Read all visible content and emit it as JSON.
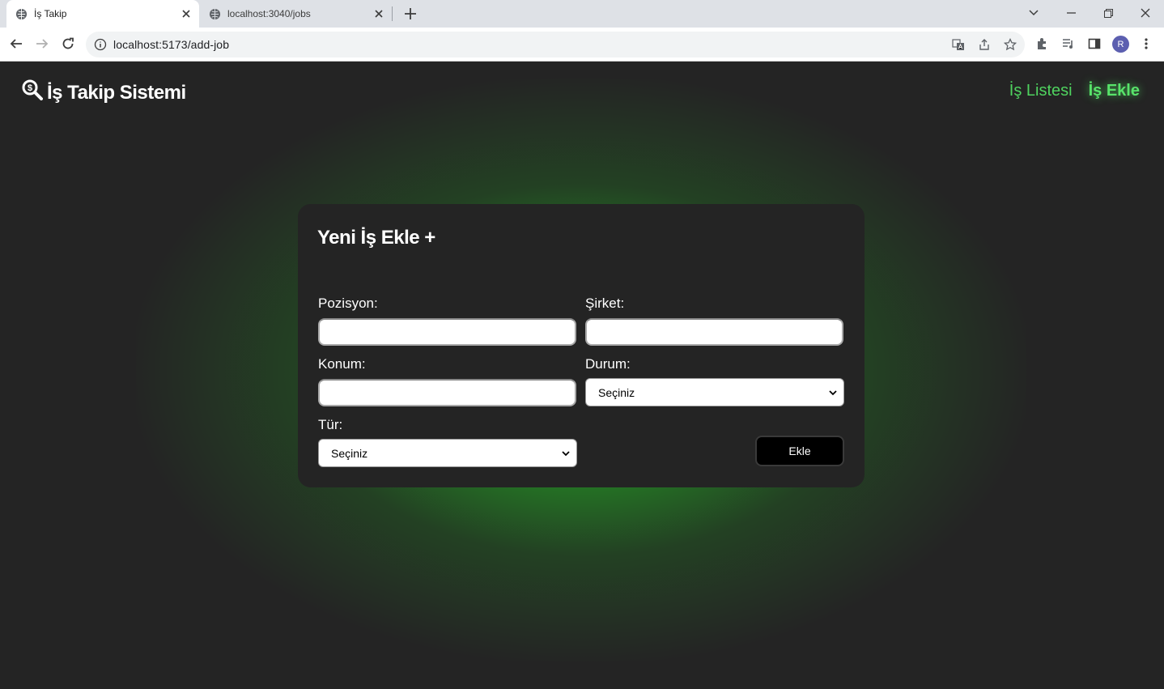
{
  "browser": {
    "tabs": [
      {
        "title": "İş Takip",
        "active": true
      },
      {
        "title": "localhost:3040/jobs",
        "active": false
      }
    ],
    "url": "localhost:5173/add-job",
    "profile_initial": "R"
  },
  "header": {
    "brand": "İş Takip Sistemi",
    "nav": [
      {
        "label": "İş Listesi"
      },
      {
        "label": "İş Ekle",
        "current": true
      }
    ]
  },
  "form": {
    "title": "Yeni İş Ekle +",
    "labels": {
      "position": "Pozisyon:",
      "company": "Şirket:",
      "location": "Konum:",
      "status": "Durum:",
      "type": "Tür:"
    },
    "values": {
      "position": "",
      "company": "",
      "location": ""
    },
    "status_selected": "Seçiniz",
    "type_selected": "Seçiniz",
    "submit_label": "Ekle"
  },
  "colors": {
    "accent": "#4fd35f",
    "glow": "#2baa2b",
    "background": "#242424"
  }
}
